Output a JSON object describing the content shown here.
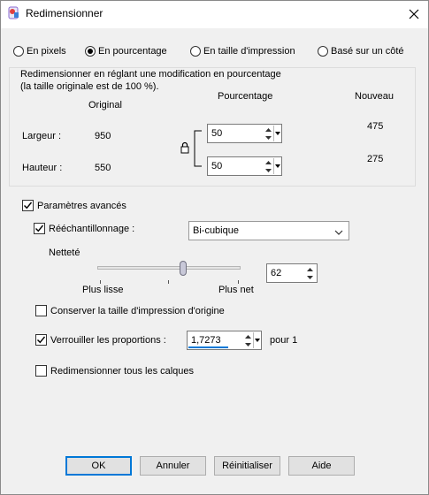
{
  "window": {
    "title": "Redimensionner"
  },
  "modes": [
    {
      "label": "En pixels",
      "checked": false
    },
    {
      "label": "En pourcentage",
      "checked": true
    },
    {
      "label": "En taille d'impression",
      "checked": false
    },
    {
      "label": "Basé sur un côté",
      "checked": false
    }
  ],
  "group": {
    "description_line1": "Redimensionner en réglant une modification en pourcentage",
    "description_line2": "(la taille originale est de 100 %).",
    "col_original": "Original",
    "col_percentage": "Pourcentage",
    "col_new": "Nouveau",
    "width_label": "Largeur :",
    "height_label": "Hauteur :",
    "width_original": "950",
    "height_original": "550",
    "width_percent": "50",
    "height_percent": "50",
    "width_new": "475",
    "height_new": "275"
  },
  "advanced": {
    "label": "Paramètres avancés",
    "checked": true,
    "resample_label": "Rééchantillonnage :",
    "resample_checked": true,
    "resample_method": "Bi-cubique",
    "sharpness_label": "Netteté",
    "sharpness_value": "62",
    "sharpness_level_percent": 62,
    "smoother_label": "Plus lisse",
    "sharper_label": "Plus net",
    "keep_print_size_label": "Conserver la taille d'impression d'origine",
    "keep_print_size_checked": false,
    "lock_ratio_label": "Verrouiller les proportions :",
    "lock_ratio_checked": true,
    "ratio_value": "1,7273",
    "ratio_suffix": "pour 1",
    "resize_all_layers_label": "Redimensionner tous les calques",
    "resize_all_layers_checked": false
  },
  "buttons": {
    "ok": "OK",
    "cancel": "Annuler",
    "reset": "Réinitialiser",
    "help": "Aide"
  },
  "colors": {
    "accent": "#0078d7"
  }
}
